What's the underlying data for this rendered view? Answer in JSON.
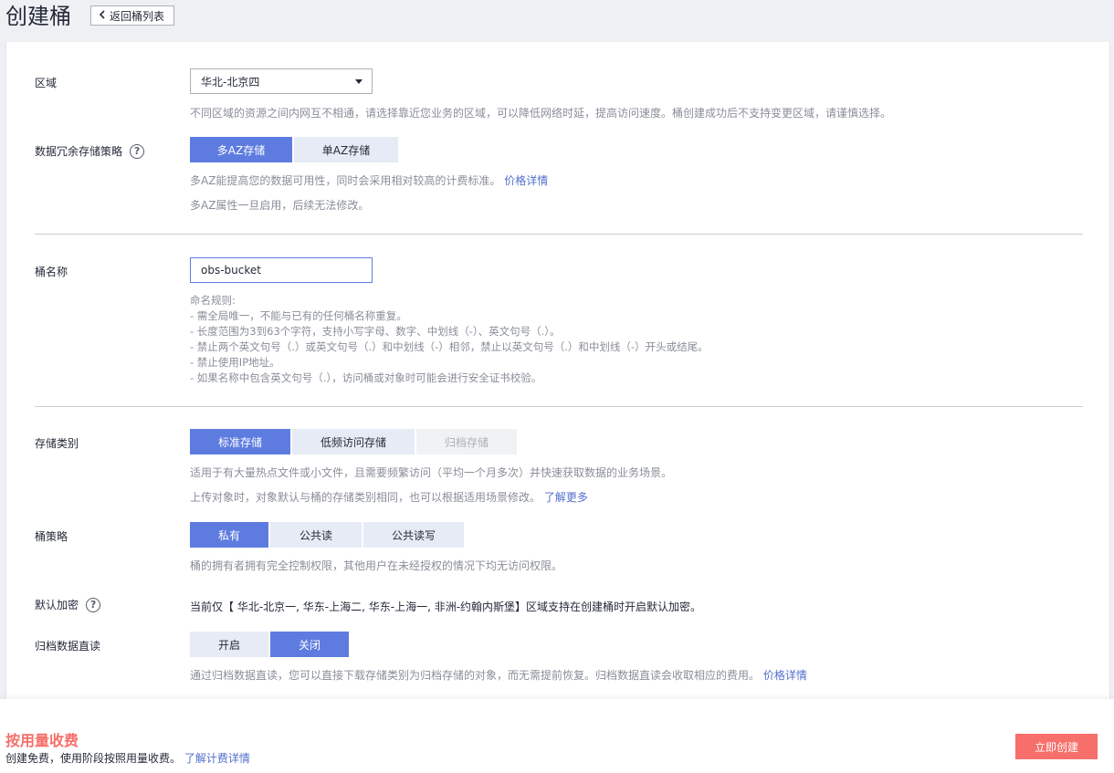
{
  "header": {
    "title": "创建桶",
    "back_label": "返回桶列表"
  },
  "region": {
    "label": "区域",
    "value": "华北-北京四",
    "hint": "不同区域的资源之间内网互不相通，请选择靠近您业务的区域，可以降低网络时延，提高访问速度。桶创建成功后不支持变更区域，请谨慎选择。"
  },
  "redundancy": {
    "label": "数据冗余存储策略",
    "options": [
      "多AZ存储",
      "单AZ存储"
    ],
    "selected": "多AZ存储",
    "hint1": "多AZ能提高您的数据可用性，同时会采用相对较高的计费标准。",
    "hint1_link": "价格详情",
    "hint2": "多AZ属性一旦启用，后续无法修改。"
  },
  "bucket_name": {
    "label": "桶名称",
    "value": "obs-bucket",
    "rules": [
      "命名规则:",
      "- 需全局唯一，不能与已有的任何桶名称重复。",
      "- 长度范围为3到63个字符，支持小写字母、数字、中划线（-）、英文句号（.）。",
      "- 禁止两个英文句号（.）或英文句号（.）和中划线（-）相邻，禁止以英文句号（.）和中划线（-）开头或结尾。",
      "- 禁止使用IP地址。",
      "- 如果名称中包含英文句号（.），访问桶或对象时可能会进行安全证书校验。"
    ]
  },
  "storage_class": {
    "label": "存储类别",
    "options": [
      "标准存储",
      "低频访问存储",
      "归档存储"
    ],
    "selected": "标准存储",
    "disabled": "归档存储",
    "hint1": "适用于有大量热点文件或小文件，且需要频繁访问（平均一个月多次）并快速获取数据的业务场景。",
    "hint2": "上传对象时，对象默认与桶的存储类别相同，也可以根据适用场景修改。",
    "hint2_link": "了解更多"
  },
  "bucket_policy": {
    "label": "桶策略",
    "options": [
      "私有",
      "公共读",
      "公共读写"
    ],
    "selected": "私有",
    "hint": "桶的拥有者拥有完全控制权限，其他用户在未经授权的情况下均无访问权限。"
  },
  "encryption": {
    "label": "默认加密",
    "note": "当前仅【 华北-北京一, 华东-上海二, 华东-上海一, 非洲-约翰内斯堡】区域支持在创建桶时开启默认加密。"
  },
  "archive_read": {
    "label": "归档数据直读",
    "options": [
      "开启",
      "关闭"
    ],
    "selected": "关闭",
    "hint": "通过归档数据直读，您可以直接下载存储类别为归档存储的对象，而无需提前恢复。归档数据直读会收取相应的费用。",
    "hint_link": "价格详情"
  },
  "footer": {
    "fee_title": "按用量收费",
    "fee_desc": "创建免费，使用阶段按照用量收费。",
    "fee_link": "了解计费详情",
    "create_label": "立即创建"
  },
  "colors": {
    "primary": "#5e7ce0",
    "danger": "#f66f6a",
    "link": "#526ecc"
  }
}
